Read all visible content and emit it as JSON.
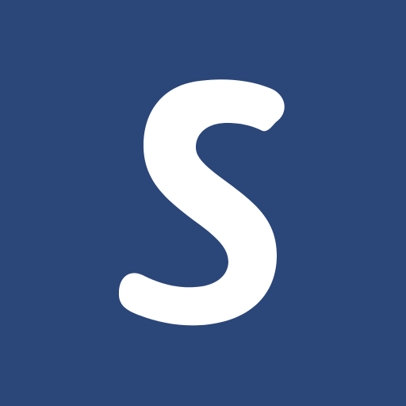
{
  "logo": {
    "letter": "S",
    "icon": "s-logo-icon",
    "background_color": "#2b4679",
    "glyph_color": "#ffffff"
  }
}
